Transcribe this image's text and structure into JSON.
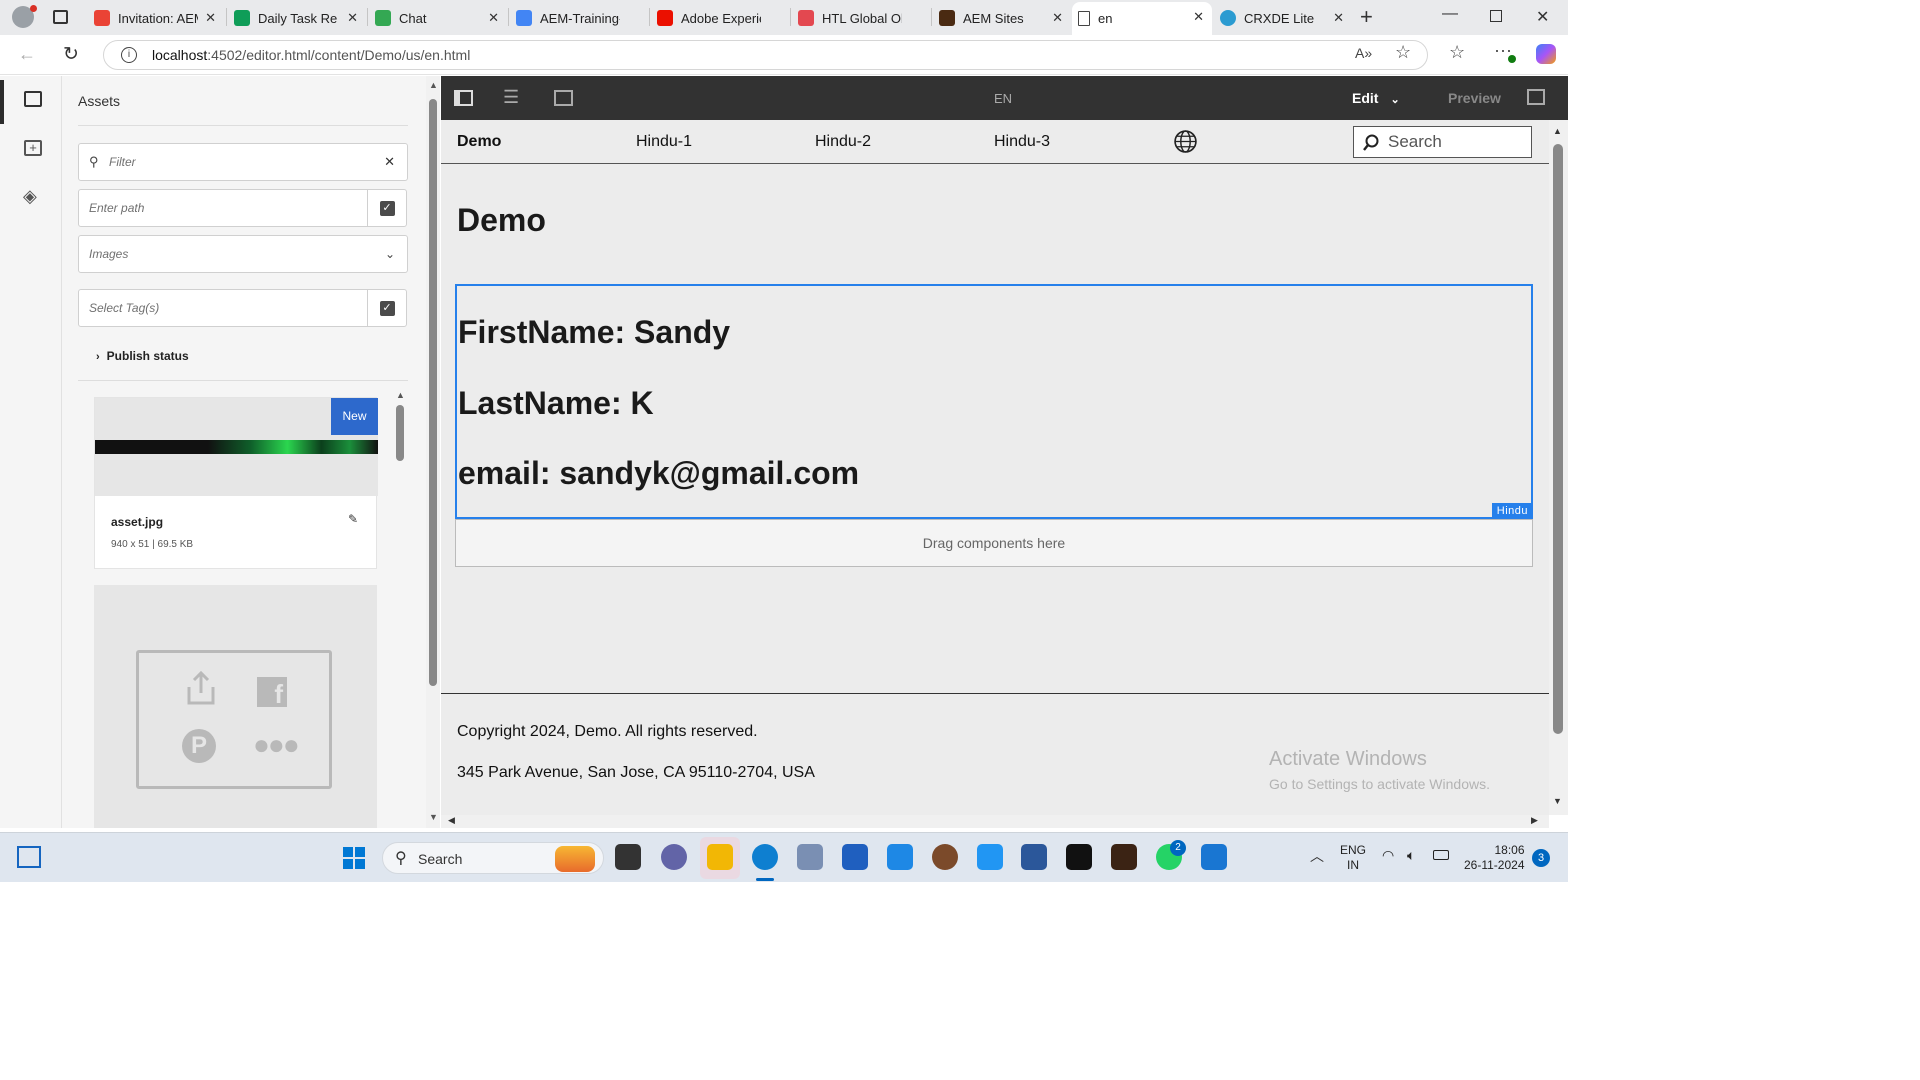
{
  "browser": {
    "tabs": [
      {
        "label": "Invitation: AEM",
        "color": "#ea4335"
      },
      {
        "label": "Daily Task Rep",
        "color": "#0f9d58"
      },
      {
        "label": "Chat",
        "color": "#34a853"
      },
      {
        "label": "AEM-Training-",
        "color": "#4285f4"
      },
      {
        "label": "Adobe Experie",
        "color": "#eb1000"
      },
      {
        "label": "HTL Global Ob",
        "color": "#e34850"
      },
      {
        "label": "AEM Sites",
        "color": "#4a2a12"
      },
      {
        "label": "en",
        "color": "#ffffff"
      },
      {
        "label": "CRXDE Lite",
        "color": "#2b9bd1"
      }
    ],
    "url_host": "localhost",
    "url_rest": ":4502/editor.html/content/Demo/us/en.html"
  },
  "side_panel": {
    "title": "Assets",
    "filter_placeholder": "Filter",
    "path_placeholder": "Enter path",
    "type_select": "Images",
    "tags_placeholder": "Select Tag(s)",
    "publish_status": "Publish status",
    "asset": {
      "badge": "New",
      "name": "asset.jpg",
      "meta": "940 x 51 | 69.5 KB"
    }
  },
  "editor": {
    "language": "EN",
    "mode": "Edit",
    "preview": "Preview"
  },
  "page": {
    "nav": {
      "brand": "Demo",
      "items": [
        "Hindu-1",
        "Hindu-2",
        "Hindu-3"
      ],
      "search_placeholder": "Search"
    },
    "title": "Demo",
    "component": {
      "lines": [
        "FirstName: Sandy",
        "LastName: K",
        "email: sandyk@gmail.com"
      ],
      "tag": "Hindu"
    },
    "drop_zone": "Drag components here",
    "footer": {
      "copyright": "Copyright 2024, Demo. All rights reserved.",
      "address": "345 Park Avenue, San Jose, CA 95110-2704, USA"
    },
    "watermark": {
      "title": "Activate Windows",
      "subtitle": "Go to Settings to activate Windows."
    }
  },
  "taskbar": {
    "search_placeholder": "Search",
    "lang_top": "ENG",
    "lang_bottom": "IN",
    "time": "18:06",
    "date": "26-11-2024",
    "notification_count": "3",
    "whatsapp_badge": "2"
  }
}
